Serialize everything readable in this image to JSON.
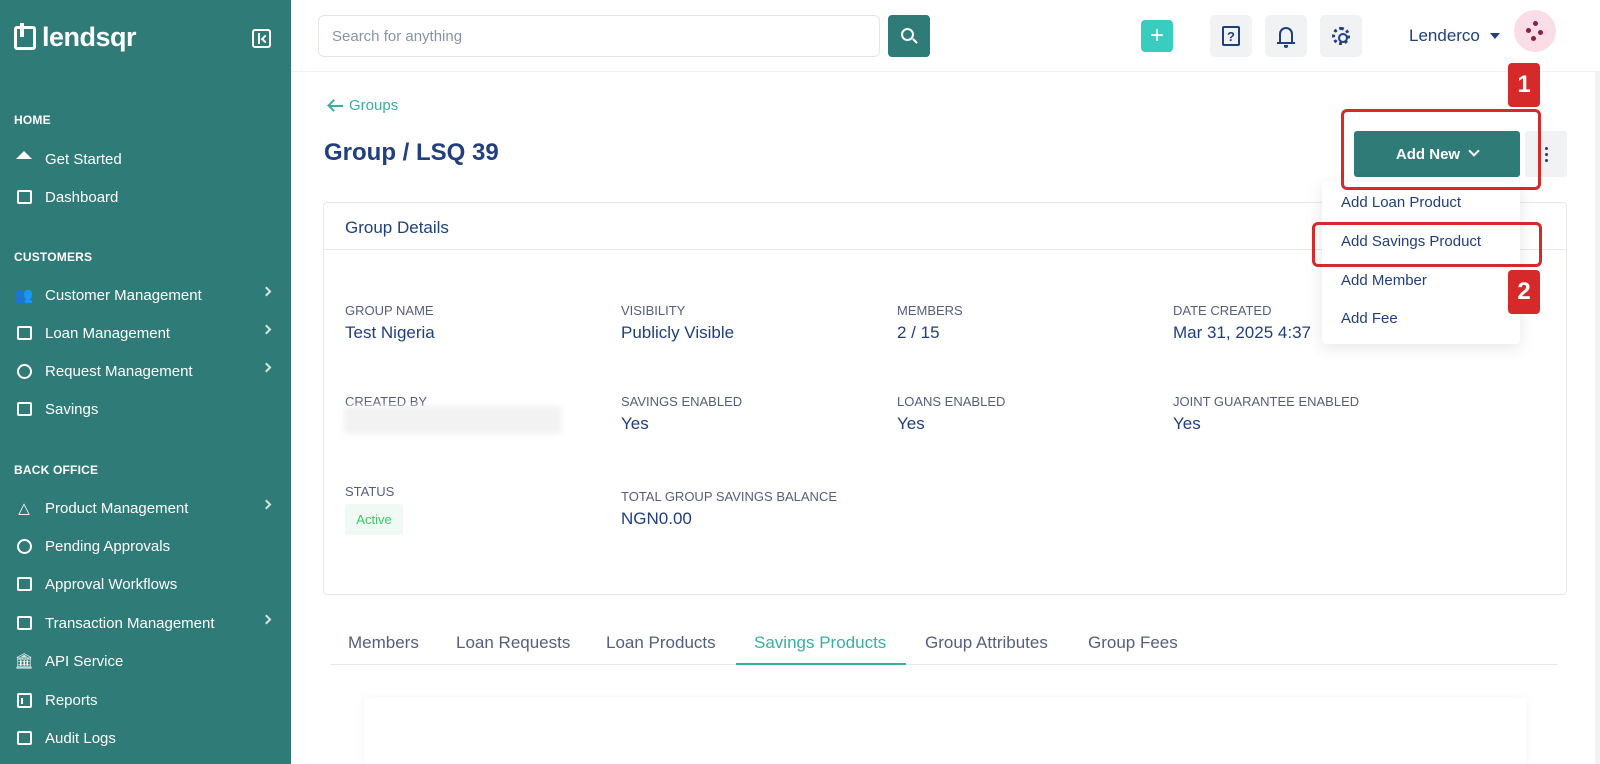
{
  "brand": {
    "name": "lendsqr"
  },
  "sidebar": {
    "sections": [
      {
        "title": "HOME"
      },
      {
        "title": "CUSTOMERS"
      },
      {
        "title": "BACK OFFICE"
      }
    ],
    "items": [
      {
        "label": "Get Started",
        "icon": "home-icon"
      },
      {
        "label": "Dashboard",
        "icon": "dashboard-icon"
      },
      {
        "label": "Customer Management",
        "icon": "users-icon",
        "has_submenu": true
      },
      {
        "label": "Loan Management",
        "icon": "bank-icon",
        "has_submenu": true
      },
      {
        "label": "Request Management",
        "icon": "request-icon",
        "has_submenu": true
      },
      {
        "label": "Savings",
        "icon": "briefcase-icon"
      },
      {
        "label": "Product Management",
        "icon": "shapes-icon",
        "has_submenu": true
      },
      {
        "label": "Pending Approvals",
        "icon": "clock-icon"
      },
      {
        "label": "Approval Workflows",
        "icon": "workflow-icon"
      },
      {
        "label": "Transaction Management",
        "icon": "transaction-icon",
        "has_submenu": true
      },
      {
        "label": "API Service",
        "icon": "building-icon"
      },
      {
        "label": "Reports",
        "icon": "chart-icon"
      },
      {
        "label": "Audit Logs",
        "icon": "clipboard-search-icon"
      }
    ]
  },
  "topbar": {
    "search_placeholder": "Search for anything",
    "user_name": "Lenderco"
  },
  "breadcrumb": {
    "back_label": "Groups"
  },
  "page": {
    "title": "Group / LSQ 39"
  },
  "actions": {
    "add_new_label": "Add New",
    "menu": [
      "Add Loan Product",
      "Add Savings Product",
      "Add Member",
      "Add Fee"
    ]
  },
  "details": {
    "title": "Group Details",
    "fields": {
      "group_name": {
        "label": "GROUP NAME",
        "value": "Test Nigeria"
      },
      "visibility": {
        "label": "VISIBILITY",
        "value": "Publicly Visible"
      },
      "members": {
        "label": "MEMBERS",
        "value": "2 / 15"
      },
      "date_created": {
        "label": "DATE CREATED",
        "value": "Mar 31, 2025 4:37"
      },
      "created_by": {
        "label": "CREATED BY"
      },
      "savings_enabled": {
        "label": "SAVINGS ENABLED",
        "value": "Yes"
      },
      "loans_enabled": {
        "label": "LOANS ENABLED",
        "value": "Yes"
      },
      "joint_guarantee": {
        "label": "JOINT GUARANTEE ENABLED",
        "value": "Yes"
      },
      "status": {
        "label": "STATUS",
        "value": "Active"
      },
      "total_savings": {
        "label": "TOTAL GROUP SAVINGS BALANCE",
        "value": "NGN0.00"
      }
    }
  },
  "tabs": [
    "Members",
    "Loan Requests",
    "Loan Products",
    "Savings Products",
    "Group Attributes",
    "Group Fees"
  ],
  "active_tab": "Savings Products",
  "annotations": {
    "step1": "1",
    "step2": "2"
  },
  "colors": {
    "sidebar_bg": "#2e7b78",
    "primary": "#2e7b78",
    "accent": "#39aea3",
    "text": "#213f7d",
    "status_green": "#39cd62",
    "annotation_red": "#d62a2a"
  }
}
